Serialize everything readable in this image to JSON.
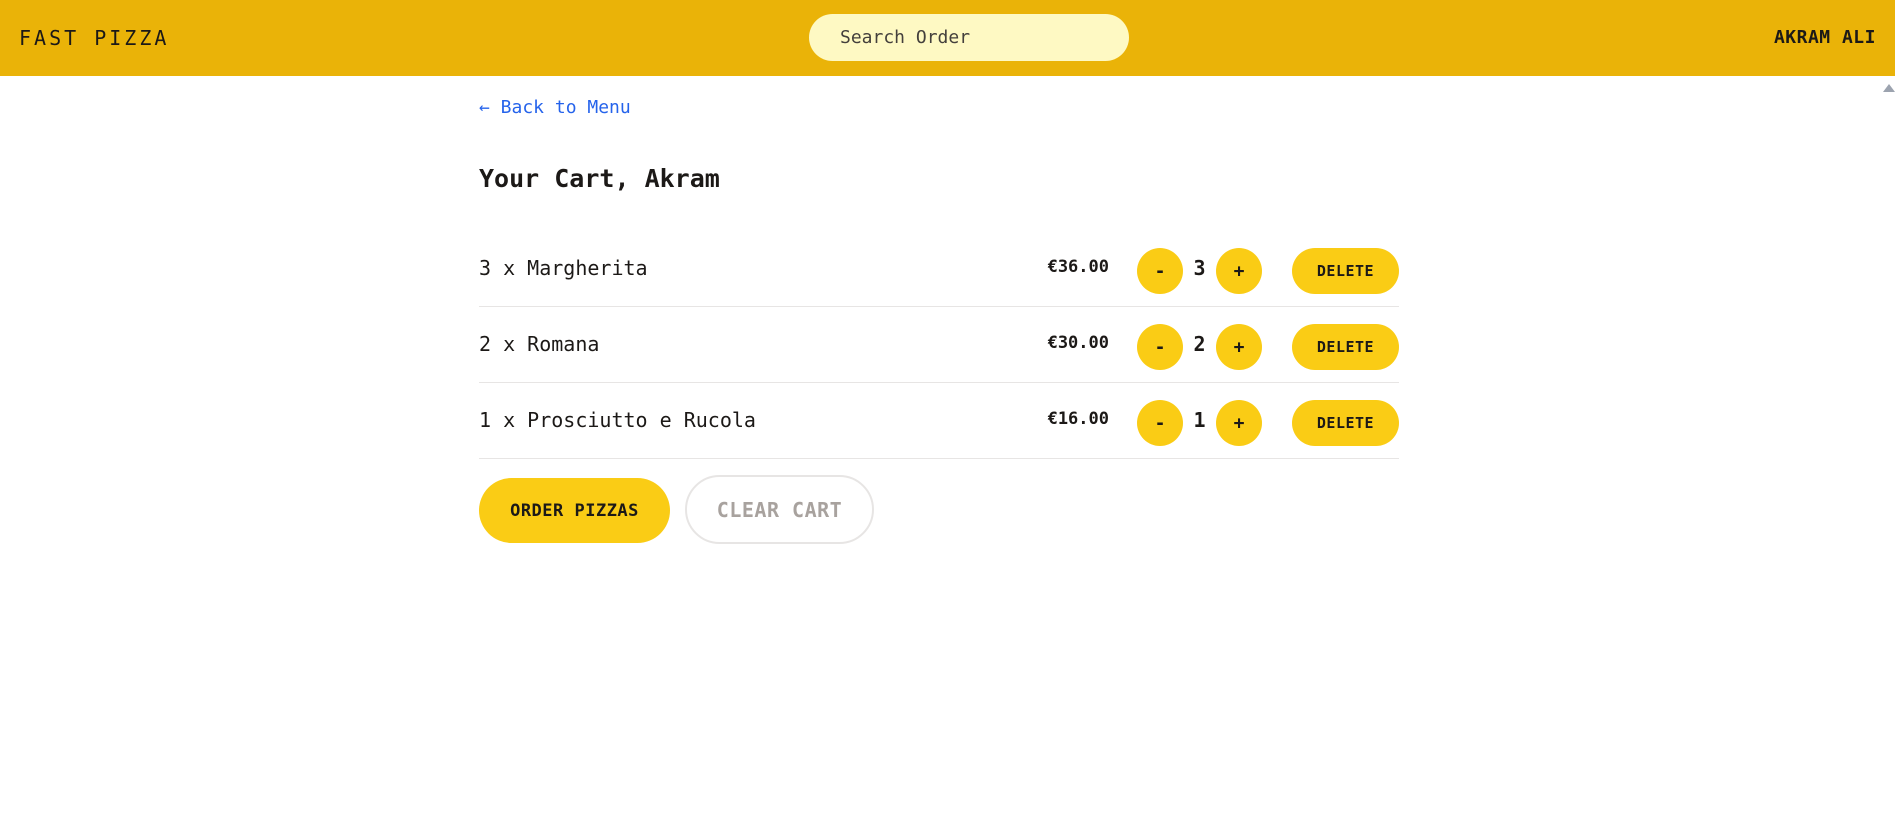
{
  "header": {
    "logo": "FAST PIZZA",
    "search_placeholder": "Search Order",
    "username": "AKRAM ALI"
  },
  "main": {
    "back_link": "← Back to Menu",
    "title": "Your Cart, Akram",
    "items": [
      {
        "name": "3 x Margherita",
        "price": "€36.00",
        "quantity": "3",
        "minus": "-",
        "plus": "+",
        "delete": "DELETE"
      },
      {
        "name": "2 x Romana",
        "price": "€30.00",
        "quantity": "2",
        "minus": "-",
        "plus": "+",
        "delete": "DELETE"
      },
      {
        "name": "1 x Prosciutto e Rucola",
        "price": "€16.00",
        "quantity": "1",
        "minus": "-",
        "plus": "+",
        "delete": "DELETE"
      }
    ],
    "order_button": "ORDER PIZZAS",
    "clear_button": "CLEAR CART"
  },
  "colors": {
    "header_bg": "#eab308",
    "button_bg": "#facc15",
    "search_bg": "#fef9c3",
    "link": "#2563eb"
  }
}
